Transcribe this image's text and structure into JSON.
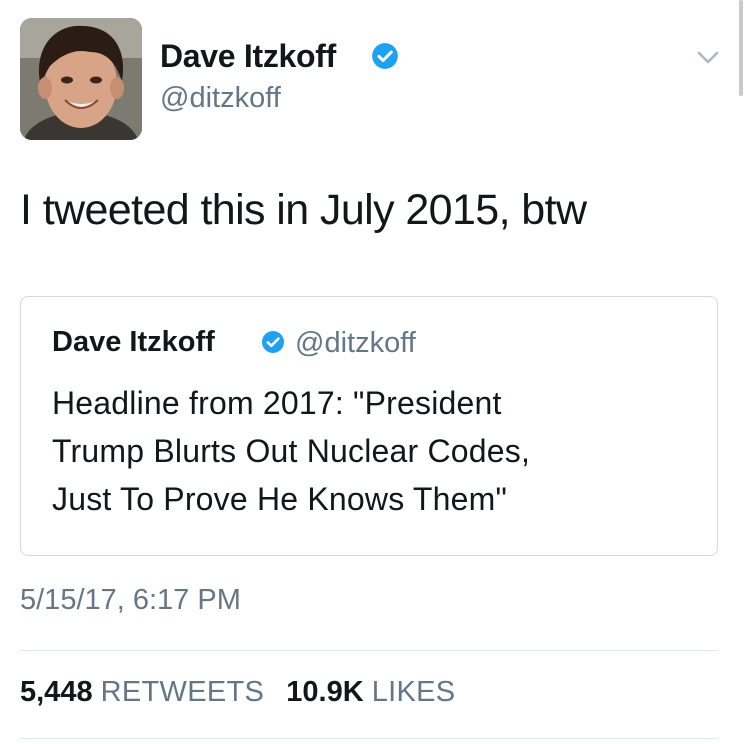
{
  "tweet": {
    "author": {
      "name": "Dave Itzkoff",
      "handle": "@ditzkoff",
      "verified": true,
      "avatar_icon": "profile-photo"
    },
    "menu_icon": "chevron-down-icon",
    "text": "I tweeted this in July 2015, btw",
    "quoted_tweet": {
      "author_name": "Dave Itzkoff",
      "author_handle": "@ditzkoff",
      "verified": true,
      "text_lines": [
        "Headline from 2017: \"President",
        "Trump Blurts Out Nuclear Codes,",
        "Just To Prove He Knows Them\""
      ]
    },
    "timestamp": "5/15/17, 6:17 PM",
    "stats": {
      "retweets_count": "5,448",
      "retweets_label": "RETWEETS",
      "likes_count": "10.9K",
      "likes_label": "LIKES"
    }
  },
  "colors": {
    "text_primary": "#14171a",
    "text_secondary": "#657786",
    "verified_blue": "#1da1f2",
    "border": "#d4d8dc",
    "divider": "#e1e8ed"
  }
}
